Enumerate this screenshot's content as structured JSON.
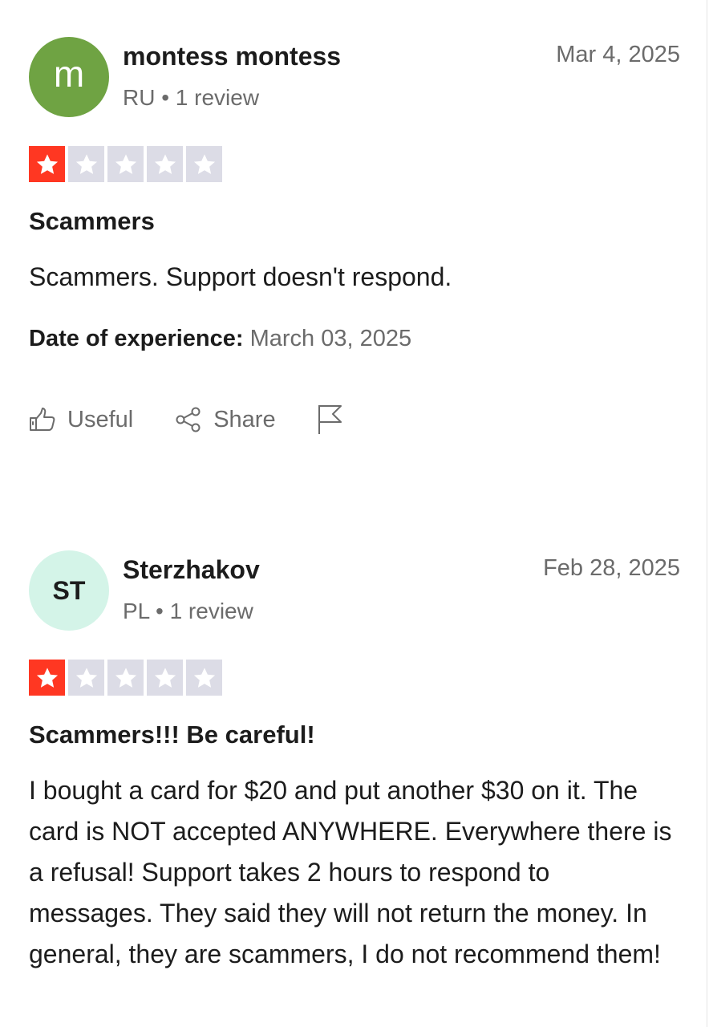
{
  "reviews": [
    {
      "avatar_text": "m",
      "avatar_color": "#6fa343",
      "name": "montess montess",
      "meta": "RU • 1 review",
      "date": "Mar 4, 2025",
      "rating": 1,
      "title": "Scammers",
      "body": "Scammers. Support doesn't respond.",
      "experience_label": "Date of experience:",
      "experience_date": "March 03, 2025",
      "useful_label": "Useful",
      "share_label": "Share"
    },
    {
      "avatar_text": "ST",
      "avatar_color": "#d4f4e8",
      "name": "Sterzhakov",
      "meta": "PL • 1 review",
      "date": "Feb 28, 2025",
      "rating": 1,
      "title": "Scammers!!! Be careful!",
      "body": "I bought a card for $20 and put another $30 on it. The card is NOT accepted ANYWHERE. Everywhere there is a refusal! Support takes 2 hours to respond to messages. They said they will not return the money. In general, they are scammers, I do not recommend them!"
    }
  ],
  "colors": {
    "star_filled": "#ff3722",
    "star_empty": "#dcdce6",
    "muted_text": "#6b6b6b"
  },
  "icons": [
    "thumbs-up-icon",
    "share-icon",
    "flag-icon",
    "star-icon"
  ]
}
